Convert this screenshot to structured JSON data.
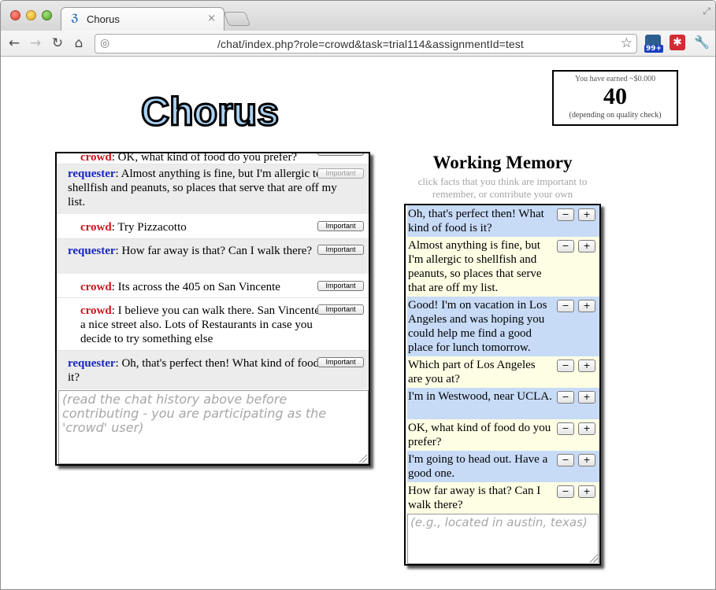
{
  "browser": {
    "tab_title": "Chorus",
    "tab_favicon": "chorus-favicon",
    "url": "/chat/index.php?role=crowd&task=trial114&assignmentId=test",
    "ext_badge": "99+"
  },
  "icons": {
    "back": "←",
    "forward": "→",
    "reload": "↻",
    "home": "⌂",
    "globe": "◎",
    "star": "☆",
    "close": "×",
    "red_ext": "✱",
    "wrench": "🔧",
    "fullscreen": "⤢",
    "favicon": "ℨ",
    "minus": "−",
    "plus": "+"
  },
  "logo": "Chorus",
  "earnings": {
    "top": "You have earned ~$0.000",
    "points": "40",
    "bottom": "(depending on quality check)"
  },
  "chat": {
    "partial_top": {
      "who": "crowd",
      "text": ": OK, what kind of food do you prefer?"
    },
    "messages": [
      {
        "who": "requester",
        "text": ": Almost anything is fine, but I'm allergic to shellfish and peanuts, so places that serve that are off my list.",
        "button": "Important"
      },
      {
        "who": "crowd",
        "text": ": Try Pizzacotto",
        "button": "Important"
      },
      {
        "who": "requester",
        "text": ": How far away is that? Can I walk there?",
        "button": "Important"
      },
      {
        "who": "crowd",
        "text": ": Its across the 405 on San Vincente",
        "button": "Important"
      },
      {
        "who": "crowd",
        "text": ": I believe you can walk there. San Vincente is a nice street also. Lots of Restaurants in case you decide to try something else",
        "button": "Important"
      },
      {
        "who": "requester",
        "text": ": Oh, that's perfect then! What kind of food is it?",
        "button": "Important"
      }
    ],
    "input_placeholder": "(read the chat history above before contributing - you are participating as the 'crowd' user)"
  },
  "working_memory": {
    "title": "Working Memory",
    "subtitle": "click facts that you think are important to remember, or contribute your own",
    "facts": [
      "Oh, that's perfect then! What kind of food is it?",
      "Almost anything is fine, but I'm allergic to shellfish and peanuts, so places that serve that are off my list.",
      "Good! I'm on vacation in Los Angeles and was hoping you could help me find a good place for lunch tomorrow.",
      "Which part of Los Angeles are you at?",
      "I'm in Westwood, near UCLA.",
      "OK, what kind of food do you prefer?",
      "I'm going to head out. Have a good one.",
      "How far away is that? Can I walk there?"
    ],
    "input_placeholder": "(e.g., located in austin, texas)"
  },
  "colors": {
    "requester": "#1725c4",
    "crowd": "#d0131a",
    "fact_blue": "#c7dbf7",
    "fact_yellow": "#fefee4",
    "logo_fill": "#a9d3f5"
  }
}
